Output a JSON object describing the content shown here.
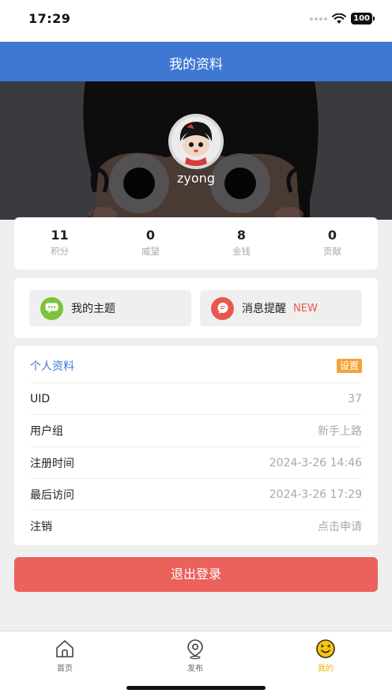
{
  "status_bar": {
    "time": "17:29",
    "battery": "100"
  },
  "nav": {
    "title": "我的资料"
  },
  "profile": {
    "username": "zyong"
  },
  "stats": [
    {
      "value": "11",
      "label": "积分"
    },
    {
      "value": "0",
      "label": "威望"
    },
    {
      "value": "8",
      "label": "金钱"
    },
    {
      "value": "0",
      "label": "贡献"
    }
  ],
  "quick_actions": {
    "topics": {
      "label": "我的主题",
      "icon": "chat-bubble-icon",
      "color": "#7ec13b"
    },
    "notifications": {
      "label": "消息提醒",
      "badge": "NEW",
      "icon": "message-icon",
      "color": "#e8584f"
    }
  },
  "personal_info": {
    "title": "个人资料",
    "settings_label": "设置",
    "rows": [
      {
        "label": "UID",
        "value": "37"
      },
      {
        "label": "用户组",
        "value": "新手上路"
      },
      {
        "label": "注册时间",
        "value": "2024-3-26 14:46"
      },
      {
        "label": "最后访问",
        "value": "2024-3-26 17:29"
      },
      {
        "label": "注销",
        "value": "点击申请"
      }
    ]
  },
  "logout": {
    "label": "退出登录"
  },
  "tab_bar": {
    "items": [
      {
        "label": "首页",
        "icon": "home-icon"
      },
      {
        "label": "发布",
        "icon": "post-icon"
      },
      {
        "label": "我的",
        "icon": "smiley-icon",
        "active": true
      }
    ]
  },
  "colors": {
    "brand_blue": "#3f78d2",
    "logout_red": "#eb615b",
    "settings_orange": "#f5a33a",
    "active_tab": "#f0b400"
  }
}
